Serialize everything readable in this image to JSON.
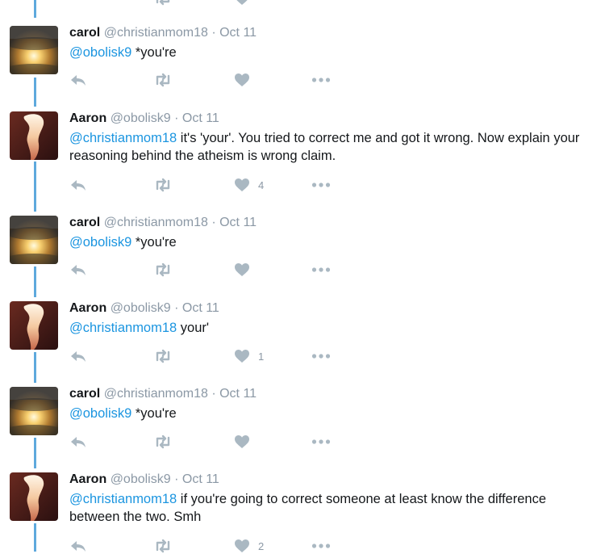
{
  "tweets": [
    {
      "author": "carol",
      "handle": "@christianmom18",
      "separator": "·",
      "date": "Oct 11",
      "mention": "@obolisk9",
      "text": " *you're",
      "like_count": "",
      "avatar": "sunset-clouds"
    },
    {
      "author": "Aaron",
      "handle": "@obolisk9",
      "separator": "·",
      "date": "Oct 11",
      "mention": "@christianmom18",
      "text": " it's 'your'. You tried to correct me and got it wrong. Now explain your reasoning behind the atheism is wrong claim.",
      "like_count": "4",
      "avatar": "flame-pillar"
    },
    {
      "author": "carol",
      "handle": "@christianmom18",
      "separator": "·",
      "date": "Oct 11",
      "mention": "@obolisk9",
      "text": " *you're",
      "like_count": "",
      "avatar": "sunset-clouds"
    },
    {
      "author": "Aaron",
      "handle": "@obolisk9",
      "separator": "·",
      "date": "Oct 11",
      "mention": "@christianmom18",
      "text": " your'",
      "like_count": "1",
      "avatar": "flame-pillar"
    },
    {
      "author": "carol",
      "handle": "@christianmom18",
      "separator": "·",
      "date": "Oct 11",
      "mention": "@obolisk9",
      "text": " *you're",
      "like_count": "",
      "avatar": "sunset-clouds"
    },
    {
      "author": "Aaron",
      "handle": "@obolisk9",
      "separator": "·",
      "date": "Oct 11",
      "mention": "@christianmom18",
      "text": " if you're going to correct someone at least know the difference between the two. Smh",
      "like_count": "2",
      "avatar": "flame-pillar"
    }
  ],
  "icons": {
    "reply": "reply-icon",
    "retweet": "retweet-icon",
    "like": "heart-icon",
    "more": "more-icon"
  },
  "colors": {
    "thread_line": "#5ea9dd",
    "mention": "#1b95e0",
    "muted": "#8b98a5",
    "icon": "#aab8c2"
  }
}
